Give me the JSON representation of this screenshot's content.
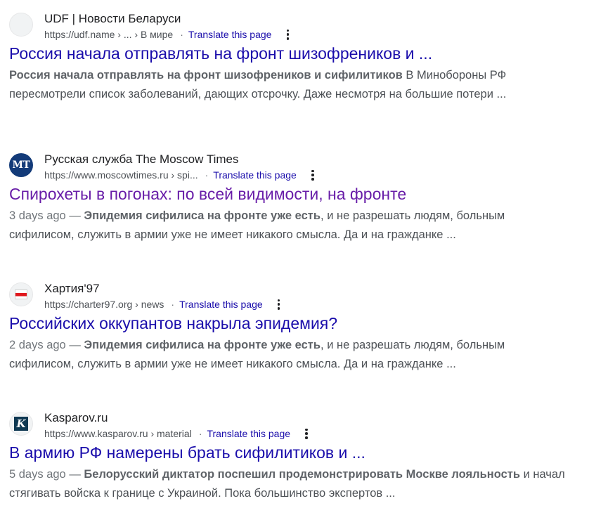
{
  "results": [
    {
      "site_name": "UDF | Новости Беларуси",
      "url": "https://udf.name › ... › В мире",
      "translate_label": "Translate this page",
      "title": "Россия начала отправлять на фронт шизофреников и ...",
      "date": "",
      "date_sep": "",
      "snippet_bold": "Россия начала отправлять на фронт шизофреников и сифилитиков",
      "snippet_rest": " В Минобороны РФ пересмотрели список заболеваний, дающих отсрочку. Даже несмотря на большие потери ...",
      "favicon": "blank-favicon-icon"
    },
    {
      "site_name": "Русская служба The Moscow Times",
      "url": "https://www.moscowtimes.ru › spi...",
      "translate_label": "Translate this page",
      "title": "Спирохеты в погонах: по всей видимости, на фронте",
      "date": "3 days ago",
      "date_sep": " — ",
      "snippet_bold": "Эпидемия сифилиса на фронте уже есть",
      "snippet_rest": ", и не разрешать людям, больным сифилисом, служить в армии уже не имеет никакого смысла. Да и на гражданке ...",
      "favicon_text": "MT",
      "favicon": "moscow-times-logo-icon"
    },
    {
      "site_name": "Хартия'97",
      "url": "https://charter97.org › news",
      "translate_label": "Translate this page",
      "title": "Российских оккупантов накрыла эпидемия?",
      "date": "2 days ago",
      "date_sep": " — ",
      "snippet_bold": "Эпидемия сифилиса на фронте уже есть",
      "snippet_rest": ", и не разрешать людям, больным сифилисом, служить в армии уже не имеет никакого смысла. Да и на гражданке ...",
      "favicon": "white-red-white-flag-icon"
    },
    {
      "site_name": "Kasparov.ru",
      "url": "https://www.kasparov.ru › material",
      "translate_label": "Translate this page",
      "title": "В армию РФ намерены брать сифилитиков и ...",
      "date": "5 days ago",
      "date_sep": " — ",
      "snippet_bold": "Белорусский диктатор поспешил продемонстрировать Москве лояльность",
      "snippet_rest": " и начал стягивать войска к границе с Украиной. Пока большинство экспертов ...",
      "favicon_text": "K",
      "favicon": "kasparov-logo-icon"
    }
  ],
  "colors": {
    "link": "#1a0dab",
    "visited_link": "#681da8",
    "snippet": "#4d5156",
    "moscow_times_blue": "#133b79",
    "flag_red": "#e0161b",
    "kasparov_navy": "#0e3852"
  }
}
